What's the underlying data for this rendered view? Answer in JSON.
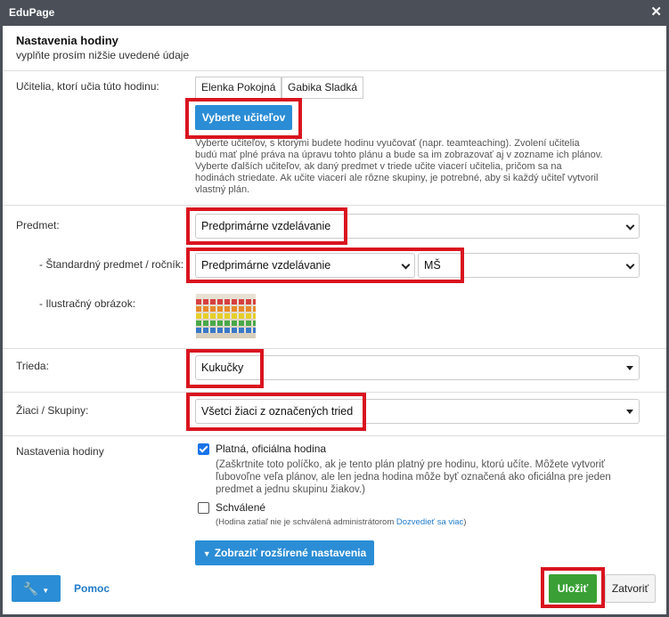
{
  "window": {
    "title": "EduPage"
  },
  "form": {
    "title": "Nastavenia hodiny",
    "subtitle": "vyplňte prosím nižšie uvedené údaje"
  },
  "teachers": {
    "label": "Učitelia, ktorí učia túto hodinu:",
    "chips": [
      "Elenka Pokojná",
      "Gabika Sladká"
    ],
    "select_button": "Vyberte učiteľov",
    "note_lines": [
      "Vyberte učiteľov, s ktorými budete hodinu vyučovať (napr. teamteaching). Zvolení učitelia",
      "budú mať plné práva na úpravu tohto plánu a bude sa im zobrazovať aj v zozname ich plánov.",
      "Vyberte ďalších učiteľov, ak daný predmet v triede učite viacerí učitelia, pričom sa na",
      "hodinách striedate. Ak učite viacerí ale rôzne skupiny, je potrebné, aby si každý učiteľ vytvoril",
      "vlastný plán."
    ]
  },
  "subject": {
    "label": "Predmet:",
    "value": "Predprimárne vzdelávanie"
  },
  "standard_subject": {
    "label": "- Štandardný predmet / ročník:",
    "value": "Predprimárne vzdelávanie",
    "grade": "MŠ"
  },
  "image": {
    "label": "- Ilustračný obrázok:",
    "icon": "abacus-image"
  },
  "class": {
    "label": "Trieda:",
    "value": "Kukučky"
  },
  "students": {
    "label": "Žiaci / Skupiny:",
    "value": "Všetci žiaci z označených tried"
  },
  "lesson_settings": {
    "label": "Nastavenia hodiny",
    "official": {
      "checked": true,
      "label": "Platná, oficiálna hodina",
      "note_lines": [
        "(Zaškrtnite toto políčko, ak je tento plán platný pre hodinu, ktorú učíte. Môžete vytvoriť",
        "ľubovoľne veľa plánov, ale len jedna hodina môže byť označená ako oficiálna pre jeden",
        "predmet a jednu skupinu žiakov.)"
      ]
    },
    "approved": {
      "checked": false,
      "label": "Schválené",
      "note": "(Hodina zatiaľ nie je schválená administrátorom",
      "link": "Dozvedieť sa viac",
      "note_end": ")"
    }
  },
  "advanced_button": "Zobraziť rozšírené nastavenia",
  "footer": {
    "tools_icon": "wrench-icon",
    "help": "Pomoc",
    "save": "Uložiť",
    "close": "Zatvoriť"
  },
  "colors": {
    "accent": "#2b8dd6",
    "save": "#3aa035",
    "highlight": "#d9141f"
  }
}
